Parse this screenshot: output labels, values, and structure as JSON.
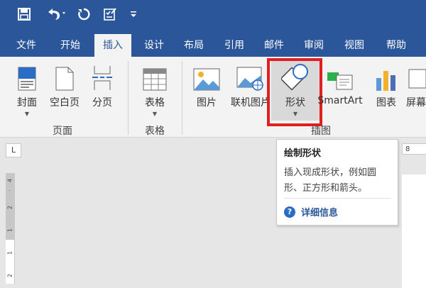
{
  "quick_access": {
    "save_icon": "save-icon",
    "undo_icon": "undo-icon",
    "redo_icon": "redo-icon",
    "check_icon": "checklist-icon",
    "customize_icon": "customize-icon"
  },
  "tabs": [
    "文件",
    "开始",
    "插入",
    "设计",
    "布局",
    "引用",
    "邮件",
    "审阅",
    "视图",
    "帮助"
  ],
  "active_tab": "插入",
  "ribbon": {
    "pages_group": {
      "label": "页面",
      "cover": "封面",
      "blank": "空白页",
      "break": "分页"
    },
    "table_group": {
      "label": "表格",
      "table": "表格"
    },
    "illustrations_group": {
      "label": "插图",
      "picture": "图片",
      "online_picture": "联机图片",
      "shapes": "形状",
      "smartart": "SmartArt",
      "chart": "图表",
      "screenshot": "屏幕"
    }
  },
  "tooltip": {
    "title": "绘制形状",
    "body": "插入现成形状，例如圆形、正方形和箭头。",
    "link": "详细信息"
  },
  "ruler": {
    "corner": "L",
    "hruler_start": "8",
    "vnums": [
      "4",
      "2",
      "1",
      "1",
      "2"
    ]
  },
  "colors": {
    "brand": "#2b579a",
    "highlight": "#e02020"
  }
}
